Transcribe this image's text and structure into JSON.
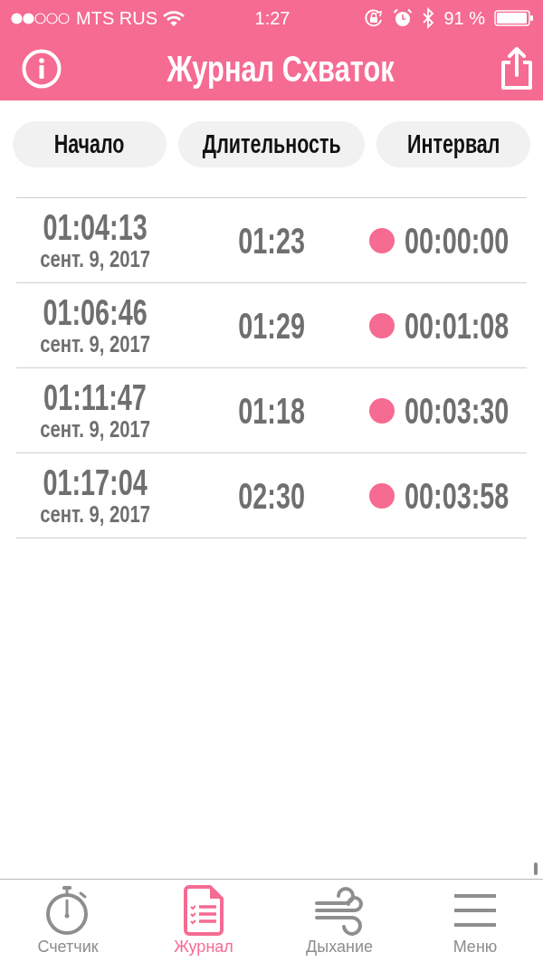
{
  "status_bar": {
    "carrier": "MTS RUS",
    "time": "1:27",
    "battery": "91 %"
  },
  "nav_bar": {
    "title": "Журнал Схваток"
  },
  "columns": [
    {
      "label": "Начало"
    },
    {
      "label": "Длительность"
    },
    {
      "label": "Интервал"
    }
  ],
  "rows": [
    {
      "start_time": "01:04:13",
      "date": "сент. 9, 2017",
      "duration": "01:23",
      "interval": "00:00:00"
    },
    {
      "start_time": "01:06:46",
      "date": "сент. 9, 2017",
      "duration": "01:29",
      "interval": "00:01:08"
    },
    {
      "start_time": "01:11:47",
      "date": "сент. 9, 2017",
      "duration": "01:18",
      "interval": "00:03:30"
    },
    {
      "start_time": "01:17:04",
      "date": "сент. 9, 2017",
      "duration": "02:30",
      "interval": "00:03:58"
    }
  ],
  "tab_bar": [
    {
      "label": "Счетчик",
      "selected": false
    },
    {
      "label": "Журнал",
      "selected": true
    },
    {
      "label": "Дыхание",
      "selected": false
    },
    {
      "label": "Меню",
      "selected": false
    }
  ]
}
